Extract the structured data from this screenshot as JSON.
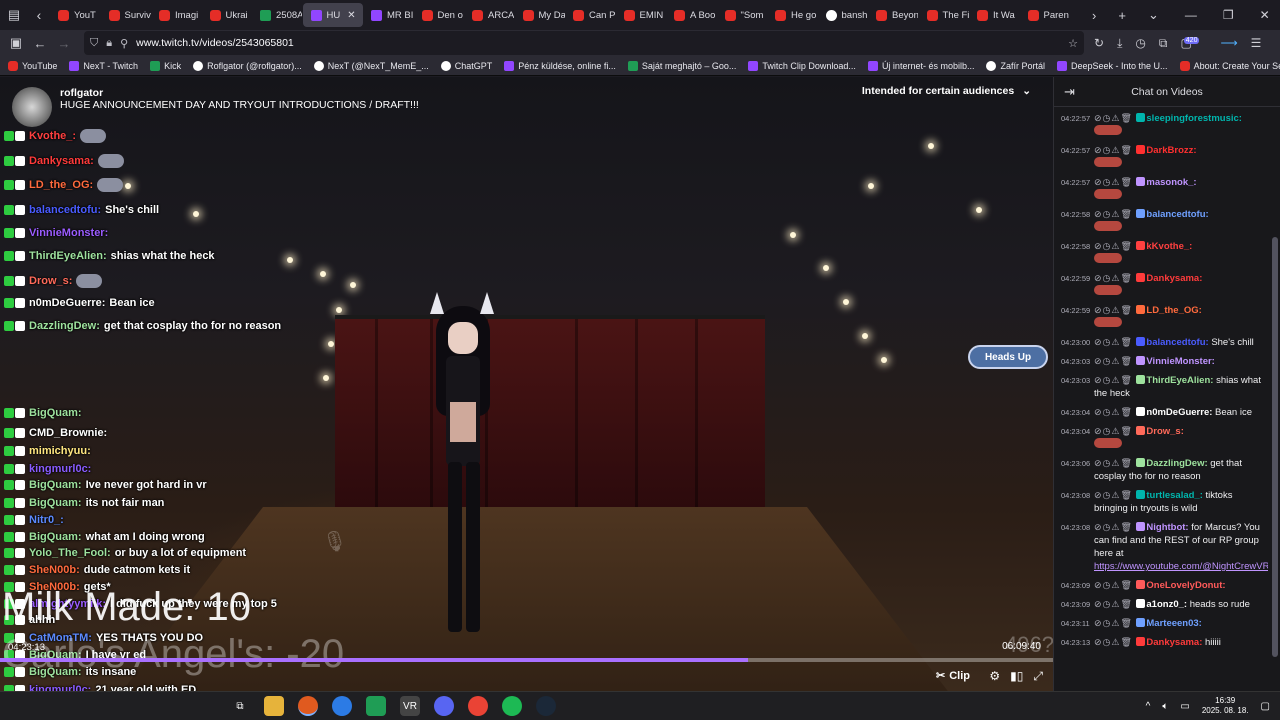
{
  "browser": {
    "tabs": [
      {
        "label": "YouT",
        "icon": "yt"
      },
      {
        "label": "Surviv",
        "icon": "yt"
      },
      {
        "label": "Imagi",
        "icon": "yt"
      },
      {
        "label": "Ukrai",
        "icon": "yt"
      },
      {
        "label": "2508A",
        "icon": "sheet"
      },
      {
        "label": "HU",
        "icon": "tw",
        "active": true
      },
      {
        "label": "MR BI",
        "icon": "tw"
      },
      {
        "label": "Den o",
        "icon": "yt"
      },
      {
        "label": "ARCA",
        "icon": "yt"
      },
      {
        "label": "My Da",
        "icon": "yt"
      },
      {
        "label": "Can Pi",
        "icon": "yt"
      },
      {
        "label": "EMIN",
        "icon": "yt"
      },
      {
        "label": "A Boo",
        "icon": "yt"
      },
      {
        "label": "\"Som",
        "icon": "yt"
      },
      {
        "label": "He go",
        "icon": "yt"
      },
      {
        "label": "bansh",
        "icon": "g"
      },
      {
        "label": "Beyon",
        "icon": "yt"
      },
      {
        "label": "The Fi",
        "icon": "yt"
      },
      {
        "label": "It Wa",
        "icon": "yt"
      },
      {
        "label": "Paren",
        "icon": "yt"
      }
    ],
    "url_host": "www.twitch.tv",
    "url_path": "/videos/2543065801",
    "extension_badge": "420",
    "bookmarks": [
      {
        "label": "YouTube",
        "icon": "yt"
      },
      {
        "label": "NexT - Twitch",
        "icon": "tw"
      },
      {
        "label": "Kick",
        "icon": "sheet"
      },
      {
        "label": "Roflgator (@roflgator)...",
        "icon": "g"
      },
      {
        "label": "NexT (@NexT_MemE_...",
        "icon": "g"
      },
      {
        "label": "ChatGPT",
        "icon": "g"
      },
      {
        "label": "Pénz küldése, online fi...",
        "icon": "tw"
      },
      {
        "label": "Saját meghajtó – Goo...",
        "icon": "sheet"
      },
      {
        "label": "Twitch Clip Download...",
        "icon": "tw"
      },
      {
        "label": "Új internet- és mobilb...",
        "icon": "tw"
      },
      {
        "label": "Zafír Portál",
        "icon": "g"
      },
      {
        "label": "DeepSeek - Into the U...",
        "icon": "tw"
      },
      {
        "label": "About: Create Your Se...",
        "icon": "yt"
      }
    ]
  },
  "video": {
    "streamer": "roflgator",
    "title": "HUGE ANNOUNCEMENT DAY AND TRYOUT INTRODUCTIONS / DRAFT!!!",
    "audience_label": "Intended for certain audiences",
    "heads_up": "Heads Up",
    "overlay_big_1": "Milk Made: 10",
    "overlay_big_2": "Carlo's Angel's: -20",
    "overlay_big_3": "496?",
    "time_current": "04:23:13",
    "time_total": "06:09:40",
    "progress_fraction": 0.71,
    "clip_label": "Clip",
    "overlay_chat": [
      {
        "user": "Kvothe_:",
        "color": "#ff4040",
        "msg": "",
        "emote": true
      },
      {
        "user": "Dankysama:",
        "color": "#ff3b3b",
        "msg": "",
        "emote": true
      },
      {
        "user": "LD_the_OG:",
        "color": "#ff6a3d",
        "msg": "",
        "emote": true
      },
      {
        "user": "balancedtofu:",
        "color": "#4a5cff",
        "msg": "She's chill"
      },
      {
        "user": "VinnieMonster:",
        "color": "#9b5cff",
        "msg": ""
      },
      {
        "user": "ThirdEyeAlien:",
        "color": "#9ee29e",
        "msg": "shias what the heck"
      },
      {
        "user": "Drow_s:",
        "color": "#ff6a5a",
        "msg": "",
        "emote": true
      },
      {
        "user": "n0mDeGuerre:",
        "color": "#ffffff",
        "msg": "Bean ice"
      },
      {
        "user": "DazzlingDew:",
        "color": "#9ee29e",
        "msg": "get that cosplay tho for no reason"
      },
      {
        "user": "BigQuam:",
        "color": "#9ee29e",
        "msg": ""
      },
      {
        "user": "CMD_Brownie:",
        "color": "#ffffff",
        "msg": ""
      },
      {
        "user": "mimichyuu:",
        "color": "#ffe680",
        "msg": ""
      },
      {
        "user": "kingmurl0c:",
        "color": "#8a5cff",
        "msg": ""
      },
      {
        "user": "BigQuam:",
        "color": "#9ee29e",
        "msg": "Ive never got hard in vr"
      },
      {
        "user": "BigQuam:",
        "color": "#9ee29e",
        "msg": "its not fair man"
      },
      {
        "user": "Nitr0_:",
        "color": "#5c8aff",
        "msg": ""
      },
      {
        "user": "BigQuam:",
        "color": "#9ee29e",
        "msg": "what am I doing wrong"
      },
      {
        "user": "Yolo_The_Fool:",
        "color": "#9ee29e",
        "msg": "or buy a lot of equipment"
      },
      {
        "user": "SheN00b:",
        "color": "#ff6a3d",
        "msg": "dude catmom kets it"
      },
      {
        "user": "SheN00b:",
        "color": "#ff6a3d",
        "msg": "gets*"
      },
      {
        "user": "almightyymilk:",
        "color": "#9b5cff",
        "msg": "I did fuck up they were my top 5"
      },
      {
        "user": "ahhh",
        "color": "#ffffff",
        "msg": ""
      },
      {
        "user": "CatMomTM:",
        "color": "#5c8aff",
        "msg": "YES THATS YOU DO"
      },
      {
        "user": "BigQuam:",
        "color": "#9ee29e",
        "msg": "I have vr ed"
      },
      {
        "user": "BigQuam:",
        "color": "#9ee29e",
        "msg": "its insane"
      },
      {
        "user": "kingmurl0c:",
        "color": "#8a5cff",
        "msg": "21 year old with ED"
      }
    ]
  },
  "chat": {
    "title": "Chat on Videos",
    "messages": [
      {
        "ts": "04:22:57",
        "user": "sleepingforestmusic:",
        "color": "#00b5ad",
        "text": "",
        "emote": true
      },
      {
        "ts": "04:22:57",
        "user": "DarkBrozz:",
        "color": "#ff3030",
        "text": "",
        "emote": true
      },
      {
        "ts": "04:22:57",
        "user": "masonok_:",
        "color": "#bf94ff",
        "text": "",
        "emote": true
      },
      {
        "ts": "04:22:58",
        "user": "balancedtofu:",
        "color": "#6fa0ff",
        "text": "",
        "emote": true
      },
      {
        "ts": "04:22:58",
        "user": "kKvothe_:",
        "color": "#ff4040",
        "text": "",
        "emote": true
      },
      {
        "ts": "04:22:59",
        "user": "Dankysama:",
        "color": "#ff3b3b",
        "text": "",
        "emote": true
      },
      {
        "ts": "04:22:59",
        "user": "LD_the_OG:",
        "color": "#ff6a3d",
        "text": "",
        "emote": true
      },
      {
        "ts": "04:23:00",
        "user": "balancedtofu:",
        "color": "#4a5cff",
        "text": "She's chill"
      },
      {
        "ts": "04:23:03",
        "user": "VinnieMonster:",
        "color": "#bf94ff",
        "text": ""
      },
      {
        "ts": "04:23:03",
        "user": "ThirdEyeAlien:",
        "color": "#9ee29e",
        "text": "shias what the heck"
      },
      {
        "ts": "04:23:04",
        "user": "n0mDeGuerre:",
        "color": "#ffffff",
        "text": "Bean ice"
      },
      {
        "ts": "04:23:04",
        "user": "Drow_s:",
        "color": "#ff6a5a",
        "text": "",
        "emote": true
      },
      {
        "ts": "04:23:06",
        "user": "DazzlingDew:",
        "color": "#9ee29e",
        "text": "get that cosplay tho for no reason"
      },
      {
        "ts": "04:23:08",
        "user": "turtlesalad_:",
        "color": "#00b5ad",
        "text": "tiktoks bringing in tryouts is wild"
      },
      {
        "ts": "04:23:08",
        "user": "Nightbot:",
        "color": "#bf94ff",
        "text": "for Marcus? You can find and the REST of our RP group here at",
        "link": "https://www.youtube.com/@NightCrewVR"
      },
      {
        "ts": "04:23:09",
        "user": "OneLovelyDonut:",
        "color": "#ff5a5a",
        "text": ""
      },
      {
        "ts": "04:23:09",
        "user": "a1onz0_:",
        "color": "#ffffff",
        "text": "heads so rude"
      },
      {
        "ts": "04:23:11",
        "user": "Marteeen03:",
        "color": "#6fa0ff",
        "text": ""
      },
      {
        "ts": "04:23:13",
        "user": "Dankysama:",
        "color": "#ff3b3b",
        "text": "hiiiii"
      }
    ]
  },
  "taskbar": {
    "time": "16:39",
    "date": "2025. 08. 18."
  }
}
